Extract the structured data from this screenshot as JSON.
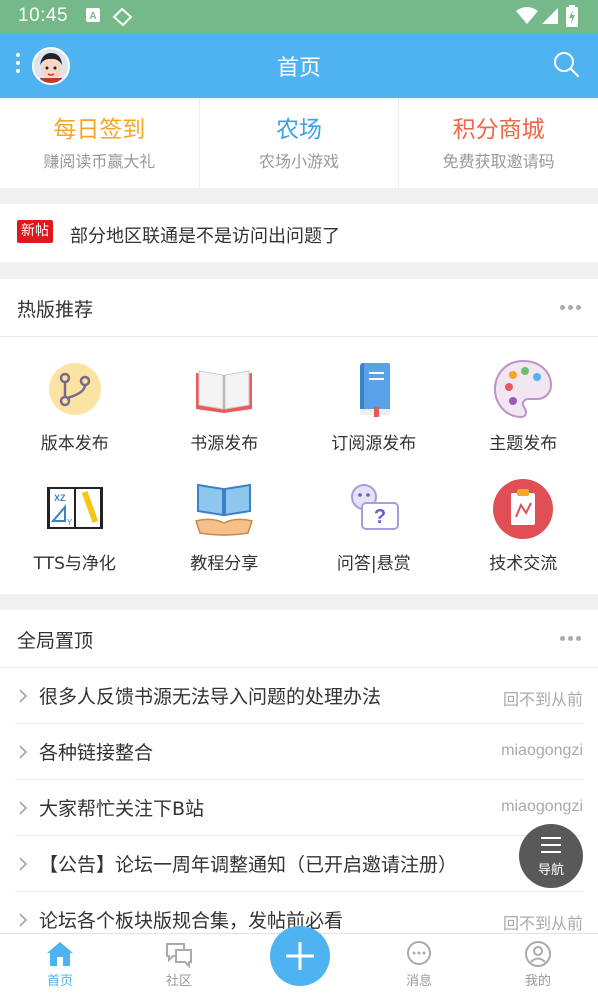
{
  "status_bar": {
    "time": "10:45"
  },
  "header": {
    "title": "首页"
  },
  "quick_links": [
    {
      "title": "每日签到",
      "subtitle": "赚阅读币赢大礼",
      "color": "#f5a623"
    },
    {
      "title": "农场",
      "subtitle": "农场小游戏",
      "color": "#3aa3e3"
    },
    {
      "title": "积分商城",
      "subtitle": "免费获取邀请码",
      "color": "#f1664b"
    }
  ],
  "notice": {
    "badge": "新帖",
    "text": "部分地区联通是不是访问出问题了"
  },
  "hot_section": {
    "title": "热版推荐",
    "items": [
      {
        "label": "版本发布",
        "icon": "version-release-icon"
      },
      {
        "label": "书源发布",
        "icon": "open-book-icon"
      },
      {
        "label": "订阅源发布",
        "icon": "notebook-icon"
      },
      {
        "label": "主题发布",
        "icon": "palette-icon"
      },
      {
        "label": "TTS与净化",
        "icon": "tts-book-icon"
      },
      {
        "label": "教程分享",
        "icon": "book-hand-icon"
      },
      {
        "label": "问答|悬赏",
        "icon": "question-chat-icon"
      },
      {
        "label": "技术交流",
        "icon": "clipboard-icon"
      }
    ]
  },
  "pinned_section": {
    "title": "全局置顶",
    "posts": [
      {
        "title": "很多人反馈书源无法导入问题的处理办法",
        "author": "回不到从前"
      },
      {
        "title": "各种链接整合",
        "author": "miaogongzi"
      },
      {
        "title": "大家帮忙关注下B站",
        "author": "miaogongzi"
      },
      {
        "title": "【公告】论坛一周年调整通知（已开启邀请注册）",
        "author": ""
      },
      {
        "title": "论坛各个板块版规合集，发帖前必看",
        "author": "回不到从前"
      }
    ]
  },
  "nav_fab": {
    "label": "导航"
  },
  "tabs": [
    {
      "label": "首页",
      "icon": "home-icon"
    },
    {
      "label": "社区",
      "icon": "community-icon"
    },
    {
      "label": "消息",
      "icon": "message-icon"
    },
    {
      "label": "我的",
      "icon": "profile-icon"
    }
  ],
  "colors": {
    "accent": "#4fb2f1",
    "status_bar": "#74b987",
    "new_badge": "#e0171b"
  }
}
